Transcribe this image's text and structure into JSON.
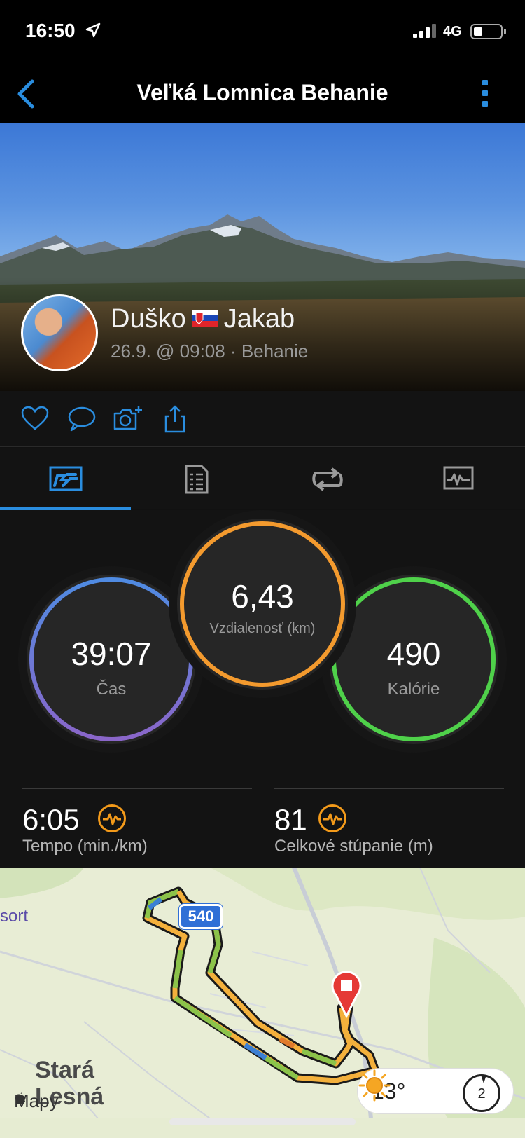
{
  "status_bar": {
    "time": "16:50",
    "network": "4G"
  },
  "nav": {
    "title": "Veľká Lomnica Behanie"
  },
  "profile": {
    "first_name": "Duško",
    "last_name": "Jakab",
    "subtitle": "26.9. @ 09:08 · Behanie"
  },
  "stats": {
    "time": {
      "value": "39:07",
      "label": "Čas"
    },
    "distance": {
      "value": "6,43",
      "label": "Vzdialenosť (km)"
    },
    "calories": {
      "value": "490",
      "label": "Kalórie"
    },
    "pace": {
      "value": "6:05",
      "label": "Tempo (min./km)"
    },
    "ascent": {
      "value": "81",
      "label": "Celkové stúpanie (m)"
    }
  },
  "map": {
    "road_number": "540",
    "partial_label": "sort",
    "town_line1": "Stará",
    "town_line2": "Lesná",
    "brand": "Mapy",
    "temperature": "13°",
    "compass_value": "2"
  },
  "colors": {
    "accent": "#2a8ddf",
    "time_ring": "#5a7fd8",
    "distance_ring": "#f39a2e",
    "calories_ring": "#4fd14a"
  },
  "icons": {
    "back": "chevron-left-icon",
    "more": "vertical-dots-icon",
    "like": "heart-icon",
    "comment": "speech-bubble-icon",
    "photo": "camera-plus-icon",
    "share": "share-icon"
  }
}
